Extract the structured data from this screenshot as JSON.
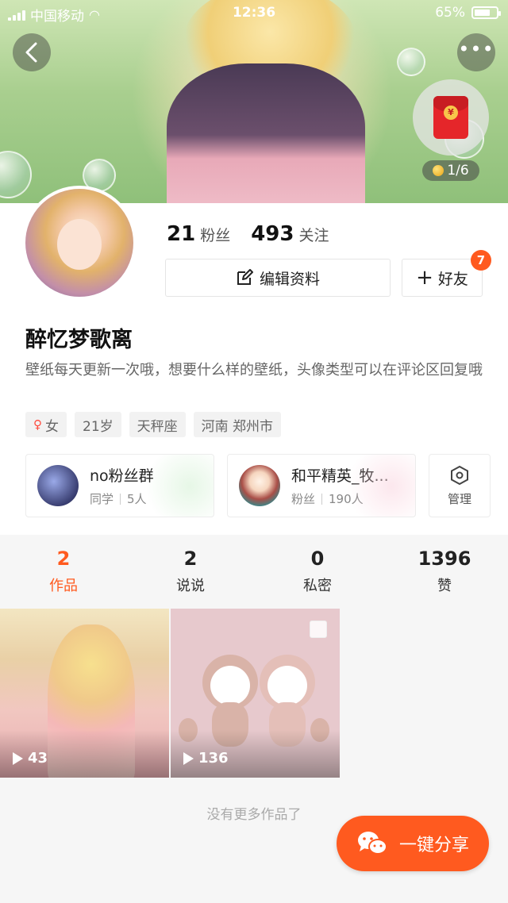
{
  "status_bar": {
    "carrier": "中国移动",
    "time": "12:36",
    "battery": "65%"
  },
  "header": {
    "red_packet_count": "1/6",
    "red_packet_symbol": "¥"
  },
  "profile": {
    "followers_count": "21",
    "followers_label": "粉丝",
    "following_count": "493",
    "following_label": "关注",
    "edit_label": "编辑资料",
    "friend_label": "好友",
    "friend_badge": "7",
    "username": "醉忆梦歌离",
    "bio": "壁纸每天更新一次哦，想要什么样的壁纸，头像类型可以在评论区回复哦",
    "tags": {
      "gender": "女",
      "age": "21岁",
      "zodiac": "天秤座",
      "location": "河南 郑州市"
    }
  },
  "groups": [
    {
      "name": "no粉丝群",
      "role": "同学",
      "members": "5人"
    },
    {
      "name": "和平精英_牧...",
      "role": "粉丝",
      "members": "190人"
    }
  ],
  "manage_label": "管理",
  "tabs": [
    {
      "count": "2",
      "label": "作品"
    },
    {
      "count": "2",
      "label": "说说"
    },
    {
      "count": "0",
      "label": "私密"
    },
    {
      "count": "1396",
      "label": "赞"
    }
  ],
  "works": [
    {
      "plays": "43"
    },
    {
      "plays": "136"
    }
  ],
  "no_more_text": "没有更多作品了",
  "share_label": "一键分享",
  "colors": {
    "accent": "#ff5a1f",
    "female": "#ff4b3e"
  }
}
